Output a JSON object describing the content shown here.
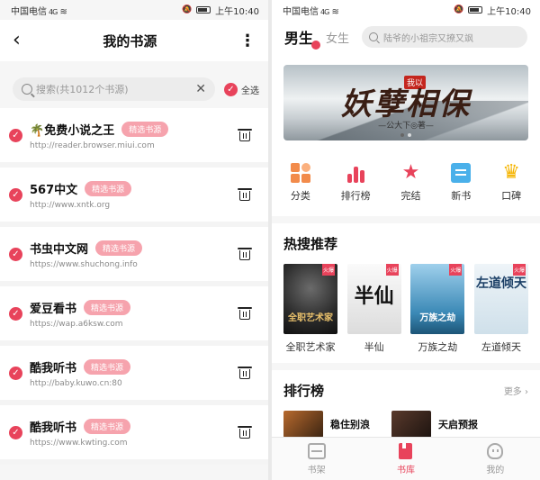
{
  "status": {
    "carrier": "中国电信",
    "signal": "4G",
    "time": "上午10:40"
  },
  "left": {
    "header": {
      "title": "我的书源"
    },
    "search": {
      "placeholder": "搜索(共1012个书源)",
      "select_all": "全选"
    },
    "sources": [
      {
        "name": "免费小说之王",
        "emoji": "🌴",
        "tag": "精选书源",
        "url": "http://reader.browser.miui.com"
      },
      {
        "name": "567中文",
        "emoji": "",
        "tag": "精选书源",
        "url": "http://www.xntk.org"
      },
      {
        "name": "书虫中文网",
        "emoji": "",
        "tag": "精选书源",
        "url": "https://www.shuchong.info"
      },
      {
        "name": "爱豆看书",
        "emoji": "",
        "tag": "精选书源",
        "url": "https://wap.a6ksw.com"
      },
      {
        "name": "酷我听书",
        "emoji": "",
        "tag": "精选书源",
        "url": "http://baby.kuwo.cn:80"
      },
      {
        "name": "酷我听书",
        "emoji": "",
        "tag": "精选书源",
        "url": "https://www.kwting.com"
      }
    ]
  },
  "right": {
    "gender_tabs": {
      "male": "男生",
      "female": "女生"
    },
    "search": {
      "placeholder": "陆爷的小祖宗又撩又飒"
    },
    "banner": {
      "title": "妖孽相保",
      "seal": "我以",
      "subtitle": "—公大下◎著—"
    },
    "categories": [
      "分类",
      "排行榜",
      "完结",
      "新书",
      "口碑"
    ],
    "hot": {
      "title": "热搜推荐",
      "hot_tag": "火爆",
      "books": [
        {
          "title": "全职艺术家",
          "cover_text": "全职艺术家"
        },
        {
          "title": "半仙",
          "cover_text": "半仙"
        },
        {
          "title": "万族之劫",
          "cover_text": "万族之劫"
        },
        {
          "title": "左道倾天",
          "cover_text": "左道倾天"
        }
      ]
    },
    "ranking": {
      "title": "排行榜",
      "more": "更多",
      "items": [
        "稳住别浪",
        "天启预报"
      ]
    },
    "tabbar": [
      "书架",
      "书库",
      "我的"
    ]
  },
  "colors": {
    "accent": "#e8435b",
    "tag_bg": "#f6a3ad"
  }
}
